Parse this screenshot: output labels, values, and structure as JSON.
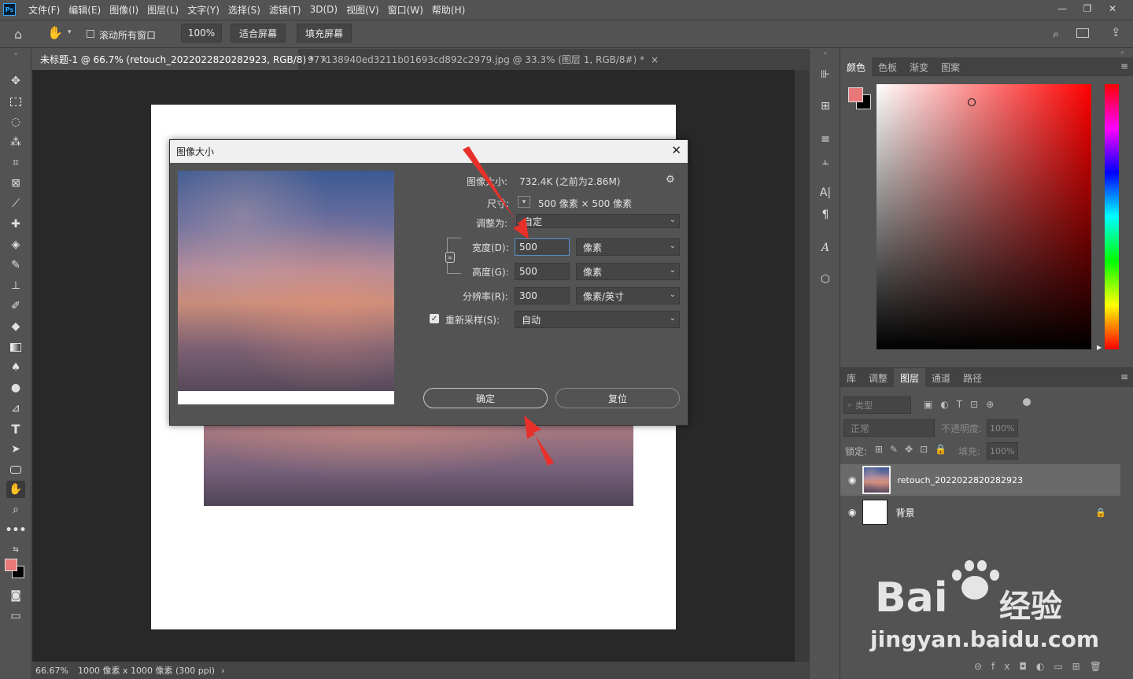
{
  "app": {
    "logo": "Ps"
  },
  "menu": [
    "文件(F)",
    "编辑(E)",
    "图像(I)",
    "图层(L)",
    "文字(Y)",
    "选择(S)",
    "滤镜(T)",
    "3D(D)",
    "视图(V)",
    "窗口(W)",
    "帮助(H)"
  ],
  "window_controls": {
    "minimize": "—",
    "restore": "❐",
    "close": "✕"
  },
  "options": {
    "scroll_all": "滚动所有窗口",
    "zoom": "100%",
    "fit_screen": "适合屏幕",
    "fill_screen": "填充屏幕"
  },
  "tabs": [
    {
      "label": "未标题-1 @ 66.7% (retouch_2022022820282923, RGB/8) *"
    },
    {
      "label": "977138940ed3211b01693cd892c2979.jpg @ 33.3% (图层 1, RGB/8#) *"
    }
  ],
  "status": {
    "zoom": "66.67%",
    "doc_info": "1000 像素 x 1000 像素 (300 ppi)",
    "arrow": "›"
  },
  "dialog": {
    "title": "图像大小",
    "image_size_label": "图像大小:",
    "image_size_value": "732.4K (之前为2.86M)",
    "dimensions_label": "尺寸:",
    "dimensions_value": "500 像素 × 500 像素",
    "fit_to_label": "调整为:",
    "fit_to_value": "自定",
    "width_label": "宽度(D):",
    "width_value": "500",
    "width_unit": "像素",
    "height_label": "高度(G):",
    "height_value": "500",
    "height_unit": "像素",
    "resolution_label": "分辨率(R):",
    "resolution_value": "300",
    "resolution_unit": "像素/英寸",
    "resample_label": "重新采样(S):",
    "resample_value": "自动",
    "ok_label": "确定",
    "reset_label": "复位"
  },
  "color_panel": {
    "tabs": [
      "颜色",
      "色板",
      "渐变",
      "图案"
    ],
    "foreground": "#e8787a",
    "background": "#000000"
  },
  "layers_panel": {
    "tabs": [
      "库",
      "调整",
      "图层",
      "通道",
      "路径"
    ],
    "filter_placeholder": "类型",
    "blend_mode": "正常",
    "opacity_label": "不透明度:",
    "opacity_value": "100%",
    "lock_label": "锁定:",
    "fill_label": "填充:",
    "fill_value": "100%",
    "layers": [
      {
        "name": "retouch_2022022820282923"
      },
      {
        "name": "背景"
      }
    ]
  },
  "watermark": {
    "brand": "Bai",
    "brand2": "经验",
    "url": "jingyan.baidu.com"
  }
}
